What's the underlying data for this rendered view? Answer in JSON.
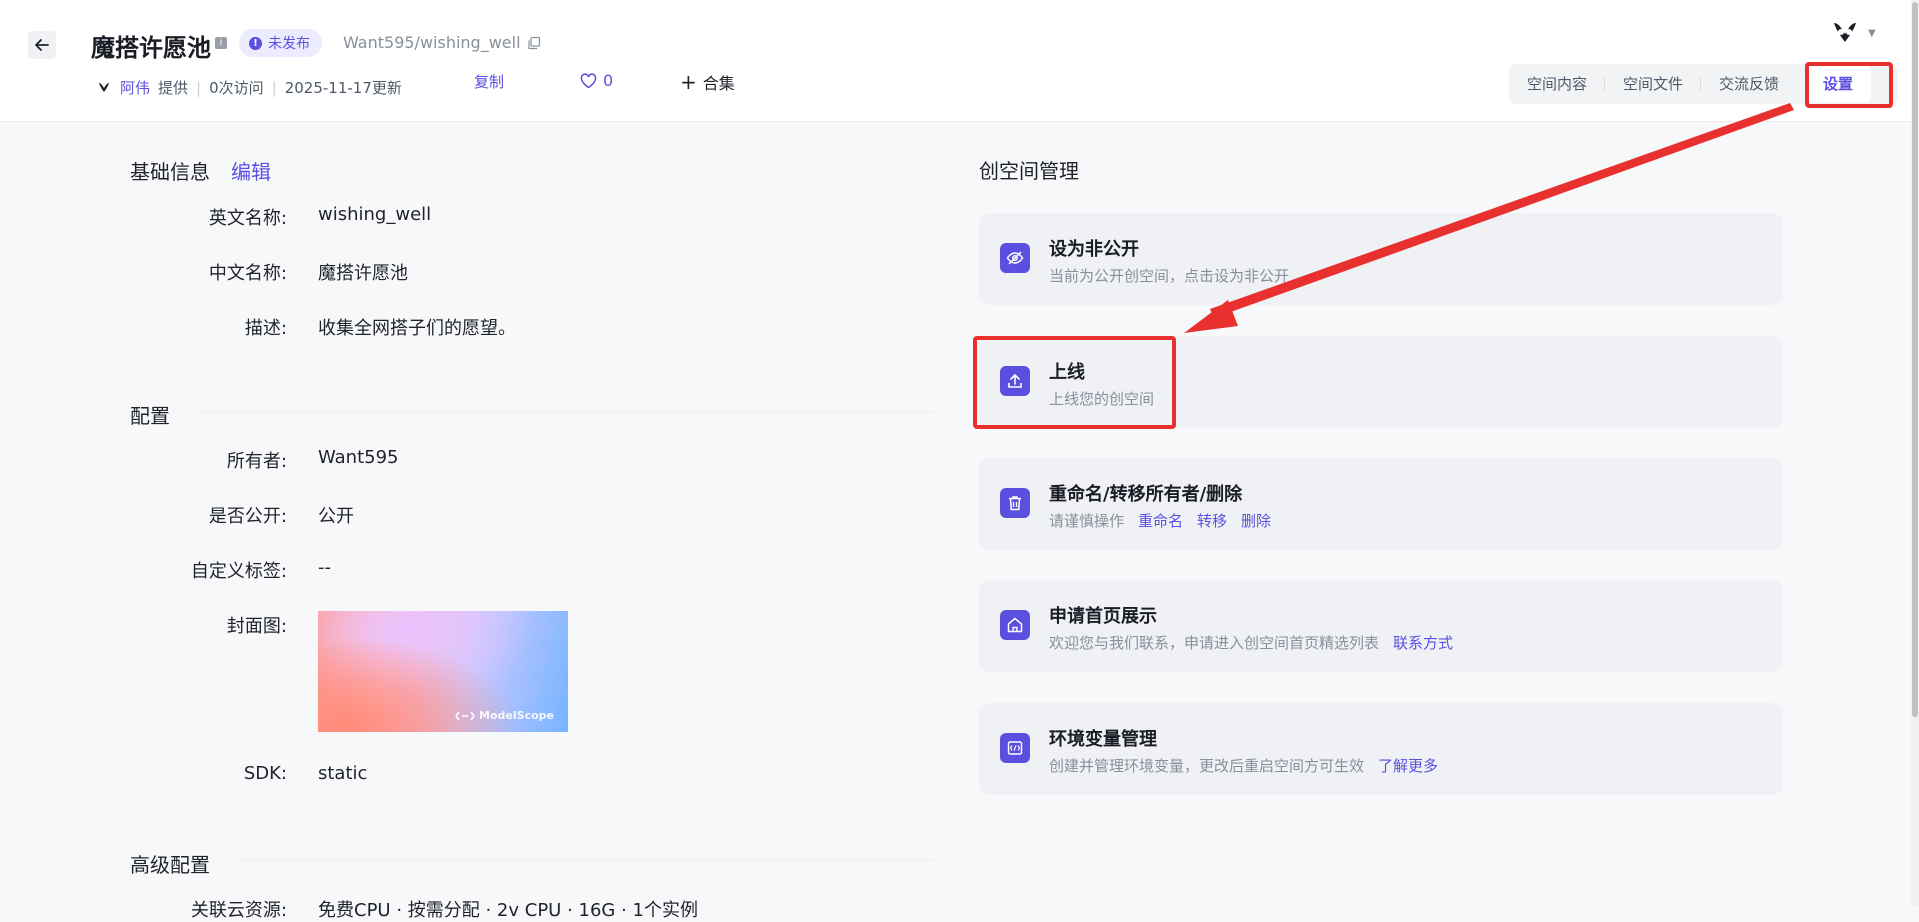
{
  "header": {
    "title": "魔搭许愿池",
    "status_badge": "未发布",
    "repo_path": "Want595/wishing_well",
    "author": "阿伟",
    "provided": "提供",
    "visits": "0次访问",
    "updated": "2025-11-17更新",
    "copy_label": "复制",
    "like_count": "0",
    "collection_label": "合集"
  },
  "tabs": [
    {
      "label": "空间内容"
    },
    {
      "label": "空间文件"
    },
    {
      "label": "交流反馈"
    },
    {
      "label": "设置",
      "active": true
    }
  ],
  "basic_info": {
    "section_title": "基础信息",
    "edit_label": "编辑",
    "fields": [
      {
        "label": "英文名称:",
        "value": "wishing_well"
      },
      {
        "label": "中文名称:",
        "value": "魔搭许愿池"
      },
      {
        "label": "描述:",
        "value": "收集全网搭子们的愿望。"
      }
    ]
  },
  "config": {
    "section_title": "配置",
    "fields": [
      {
        "label": "所有者:",
        "value": "Want595"
      },
      {
        "label": "是否公开:",
        "value": "公开"
      },
      {
        "label": "自定义标签:",
        "value": "--"
      },
      {
        "label": "封面图:",
        "value": ""
      },
      {
        "label": "SDK:",
        "value": "static"
      }
    ],
    "cover_watermark": "ModelScope"
  },
  "advanced": {
    "section_title": "高级配置",
    "partial_row_label": "关联云资源:",
    "partial_row_value": "免费CPU · 按需分配 · 2v CPU · 16G · 1个实例"
  },
  "management": {
    "title": "创空间管理",
    "cards": [
      {
        "title": "设为非公开",
        "desc": "当前为公开创空间，点击设为非公开",
        "links": [],
        "icon": "eye-off-icon"
      },
      {
        "title": "上线",
        "desc": "上线您的创空间",
        "links": [],
        "icon": "upload-icon"
      },
      {
        "title": "重命名/转移所有者/删除",
        "desc": "请谨慎操作",
        "links": [
          "重命名",
          "转移",
          "删除"
        ],
        "icon": "trash-icon"
      },
      {
        "title": "申请首页展示",
        "desc": "欢迎您与我们联系，申请进入创空间首页精选列表",
        "links": [
          "联系方式"
        ],
        "icon": "home-icon"
      },
      {
        "title": "环境变量管理",
        "desc": "创建并管理环境变量，更改后重启空间方可生效",
        "links": [
          "了解更多"
        ],
        "icon": "variable-icon"
      }
    ]
  },
  "colors": {
    "accent": "#5b4fe0",
    "annotation_red": "#e8312f",
    "card_bg": "#f0f1f5"
  }
}
